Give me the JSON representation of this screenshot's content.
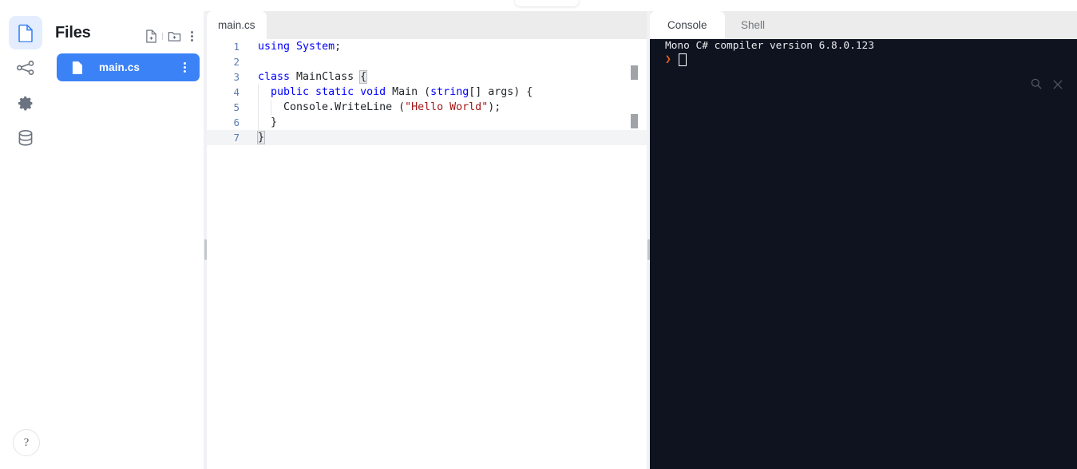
{
  "toolbar": {
    "run_button_label": ""
  },
  "rail": {
    "items": [
      {
        "icon": "file-icon",
        "name": "files",
        "active": true
      },
      {
        "icon": "share-nodes-icon",
        "name": "version-control",
        "active": false
      },
      {
        "icon": "gear-icon",
        "name": "settings",
        "active": false
      },
      {
        "icon": "database-icon",
        "name": "database",
        "active": false
      }
    ],
    "help_label": "?"
  },
  "files_panel": {
    "title": "Files",
    "actions": [
      {
        "icon": "new-file-icon",
        "label": "New file"
      },
      {
        "icon": "new-folder-icon",
        "label": "New folder"
      },
      {
        "icon": "kebab-menu-icon",
        "label": "More options"
      }
    ],
    "items": [
      {
        "name": "main.cs",
        "icon": "file-icon",
        "selected": true
      }
    ]
  },
  "editor": {
    "tabs": [
      {
        "label": "main.cs",
        "active": true
      }
    ],
    "active_line": 7,
    "lines": [
      {
        "number": "1",
        "tokens": [
          {
            "text": "using ",
            "type": "keyword"
          },
          {
            "text": "System",
            "type": "keyword"
          },
          {
            "text": ";",
            "type": "plain"
          }
        ]
      },
      {
        "number": "2",
        "tokens": []
      },
      {
        "number": "3",
        "tokens": [
          {
            "text": "class ",
            "type": "keyword"
          },
          {
            "text": "MainClass ",
            "type": "plain"
          },
          {
            "text": "{",
            "type": "brace-match"
          }
        ]
      },
      {
        "number": "4",
        "tokens": [
          {
            "text": "  ",
            "type": "plain"
          },
          {
            "text": "public static void ",
            "type": "keyword"
          },
          {
            "text": "Main (",
            "type": "plain"
          },
          {
            "text": "string",
            "type": "keyword"
          },
          {
            "text": "[] args) {",
            "type": "plain"
          }
        ]
      },
      {
        "number": "5",
        "tokens": [
          {
            "text": "    Console.WriteLine (",
            "type": "plain"
          },
          {
            "text": "\"Hello World\"",
            "type": "string"
          },
          {
            "text": ");",
            "type": "plain"
          }
        ]
      },
      {
        "number": "6",
        "tokens": [
          {
            "text": "  }",
            "type": "plain"
          }
        ]
      },
      {
        "number": "7",
        "tokens": [
          {
            "text": "}",
            "type": "brace-match"
          }
        ]
      }
    ]
  },
  "console": {
    "tabs": [
      {
        "label": "Console",
        "active": true
      },
      {
        "label": "Shell",
        "active": false
      }
    ],
    "output": "Mono C# compiler version 6.8.0.123",
    "prompt_symbol": "❯",
    "tools": [
      {
        "icon": "search-icon",
        "label": "Search console"
      },
      {
        "icon": "close-icon",
        "label": "Close console"
      }
    ]
  },
  "colors": {
    "accent_blue": "#3b82f6",
    "rail_active_bg": "#e3edfd",
    "console_bg": "#0f1320",
    "prompt_orange": "#e8641a",
    "keyword_blue": "#0000ff",
    "string_red": "#a31515",
    "lineno_blue": "#5b7bb4"
  }
}
